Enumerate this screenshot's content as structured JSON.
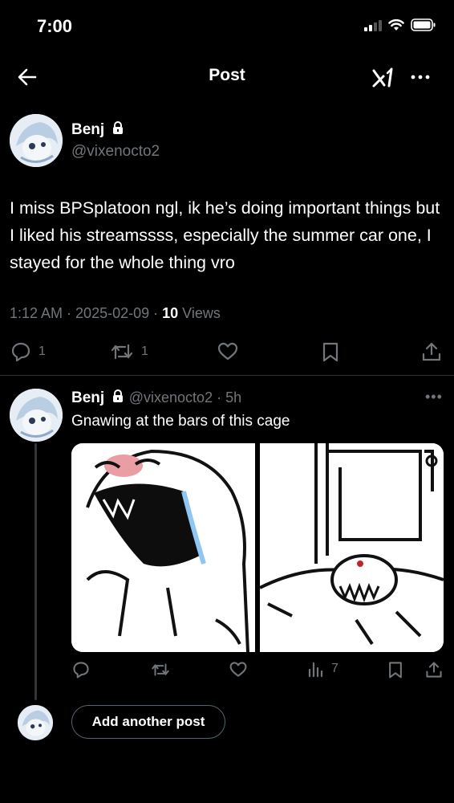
{
  "status_bar": {
    "time": "7:00"
  },
  "nav": {
    "title": "Post"
  },
  "post": {
    "author_name": "Benj",
    "handle": "@vixenocto2",
    "text": "I miss BPSplatoon ngl, ik he’s doing important things but I liked his streamssss, especially the summer car one, I stayed for the whole thing vro",
    "time": "1:12 AM",
    "date": "2025-02-09",
    "views_count": "10",
    "views_label": "Views",
    "reply_count": "1",
    "repost_count": "1"
  },
  "reply": {
    "author_name": "Benj",
    "handle": "@vixenocto2",
    "age": "5h",
    "text": "Gnawing at the bars of this cage",
    "views_count": "7"
  },
  "compose": {
    "add_label": "Add another post"
  },
  "colors": {
    "background": "#000000",
    "text": "#e7e9ea",
    "muted": "#71767b",
    "divider": "#2f3336"
  },
  "icons": [
    "back-arrow-icon",
    "grok-icon",
    "more-icon",
    "lock-icon",
    "reply-icon",
    "repost-icon",
    "like-icon",
    "bookmark-icon",
    "share-icon",
    "views-icon"
  ]
}
